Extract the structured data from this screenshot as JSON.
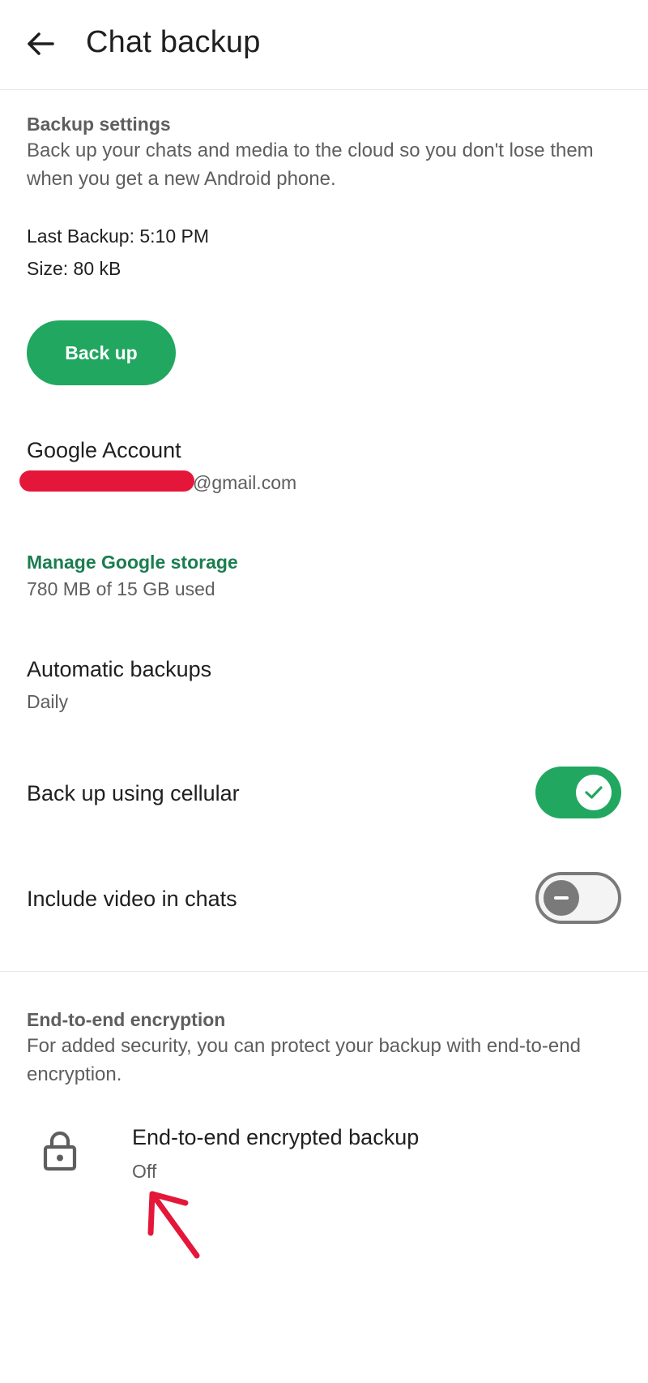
{
  "header": {
    "title": "Chat backup",
    "back_icon": "arrow-left-icon"
  },
  "backup_settings": {
    "title": "Backup settings",
    "description": "Back up your chats and media to the cloud so you don't lose them when you get a new Android phone.",
    "last_backup": "Last Backup: 5:10 PM",
    "size": "Size: 80 kB",
    "button_label": "Back up"
  },
  "account": {
    "title": "Google Account",
    "email_suffix": "@gmail.com"
  },
  "storage": {
    "link_label": "Manage Google storage",
    "usage": "780 MB of 15 GB used"
  },
  "automatic": {
    "title": "Automatic backups",
    "value": "Daily"
  },
  "cellular": {
    "label": "Back up using cellular",
    "enabled": true
  },
  "video": {
    "label": "Include video in chats",
    "enabled": false
  },
  "encryption": {
    "title": "End-to-end encryption",
    "description": "For added security, you can protect your backup with end-to-end encryption.",
    "item_title": "End-to-end encrypted backup",
    "item_status": "Off",
    "icon": "lock-icon"
  },
  "colors": {
    "accent": "#21a75f",
    "link": "#1b7d50",
    "annotation": "#e4173a"
  }
}
